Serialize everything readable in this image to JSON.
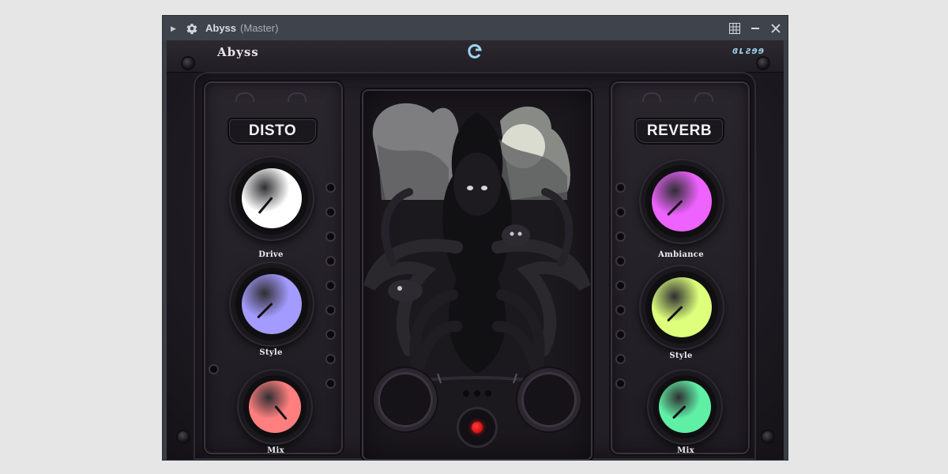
{
  "window": {
    "title": "Abyss",
    "subtitle": "(Master)"
  },
  "titlebar_icons": [
    "expand-arrow-icon",
    "gear-icon",
    "grid-icon",
    "minimize-icon",
    "close-icon"
  ],
  "plugin": {
    "brand_left": "Abyss",
    "brand_right": "ɞʟƨɘɘ",
    "colors": {
      "background": "#1c1a20",
      "panel": "#26222a",
      "led": "#e01010"
    }
  },
  "disto": {
    "header": "DISTO",
    "knobs": [
      {
        "label": "Drive",
        "color": "#ffffff"
      },
      {
        "label": "Style",
        "color": "#a39bff"
      },
      {
        "label": "Mix",
        "color": "#ff7f7f"
      }
    ]
  },
  "reverb": {
    "header": "REVERB",
    "knobs": [
      {
        "label": "Ambiance",
        "color": "#ee62ff"
      },
      {
        "label": "Style",
        "color": "#ddff7b"
      },
      {
        "label": "Mix",
        "color": "#5ff0a6"
      }
    ]
  }
}
